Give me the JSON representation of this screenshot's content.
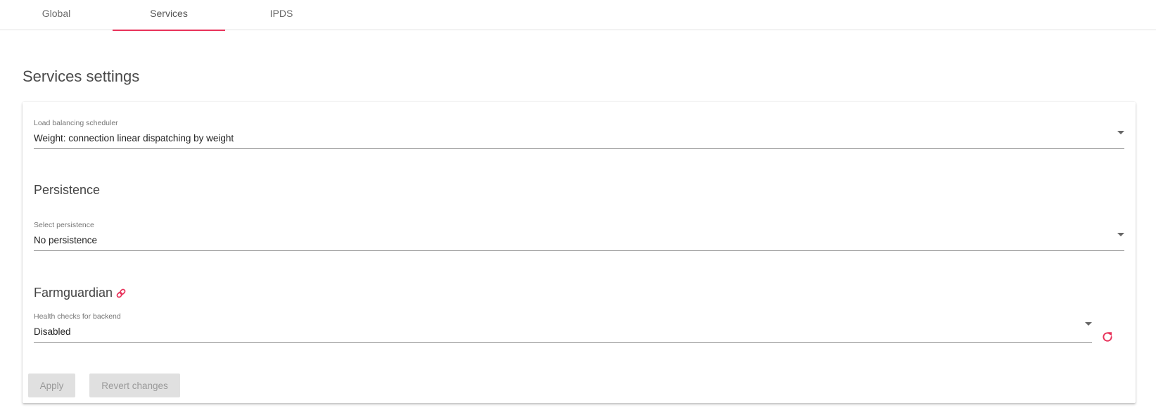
{
  "tabs": [
    {
      "label": "Global",
      "active": false
    },
    {
      "label": "Services",
      "active": true
    },
    {
      "label": "IPDS",
      "active": false
    }
  ],
  "page_title": "Services settings",
  "scheduler": {
    "label": "Load balancing scheduler",
    "value": "Weight: connection linear dispatching by weight"
  },
  "persistence": {
    "section_title": "Persistence",
    "label": "Select persistence",
    "value": "No persistence"
  },
  "farmguardian": {
    "section_title": "Farmguardian",
    "label": "Health checks for backend",
    "value": "Disabled"
  },
  "buttons": {
    "apply": "Apply",
    "revert": "Revert changes"
  },
  "colors": {
    "accent": "#e8325a",
    "button_disabled_bg": "#e0e0e0",
    "button_disabled_text": "#9a9a9a"
  },
  "icons": {
    "farmguardian_link": "link-icon",
    "reload": "refresh-icon",
    "dropdown": "chevron-down-icon"
  }
}
